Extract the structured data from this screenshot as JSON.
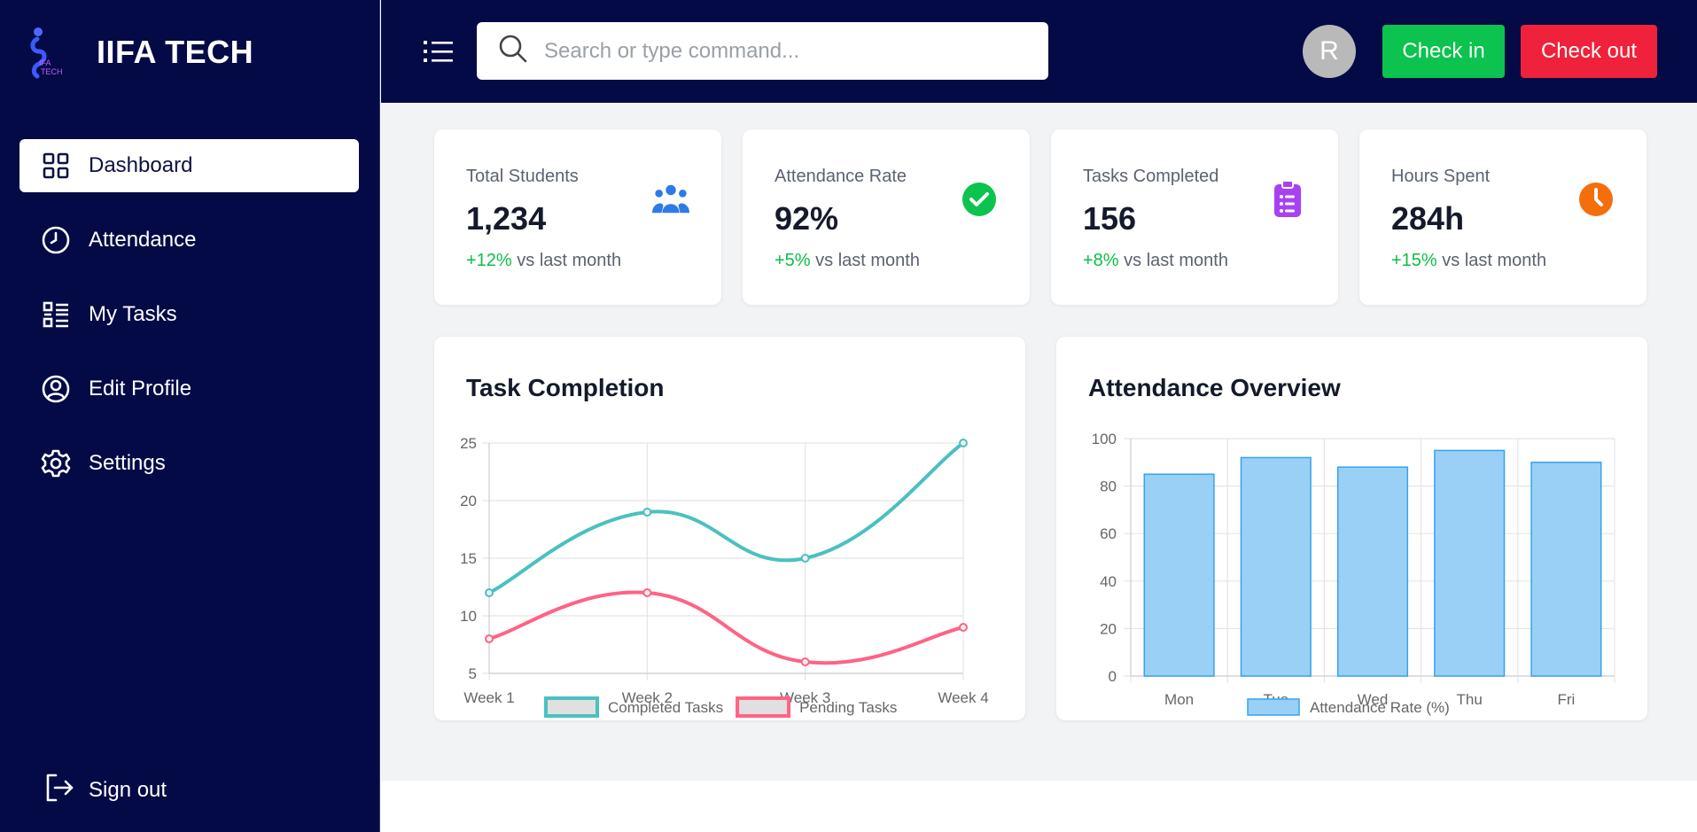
{
  "brand": {
    "name": "IIFA TECH",
    "logo_text": "IFA TECH"
  },
  "sidebar": {
    "items": [
      {
        "label": "Dashboard",
        "icon": "grid-icon",
        "active": true
      },
      {
        "label": "Attendance",
        "icon": "clock-icon",
        "active": false
      },
      {
        "label": "My Tasks",
        "icon": "list-icon",
        "active": false
      },
      {
        "label": "Edit Profile",
        "icon": "user-circle-icon",
        "active": false
      },
      {
        "label": "Settings",
        "icon": "gear-icon",
        "active": false
      }
    ],
    "signout_label": "Sign out"
  },
  "topbar": {
    "search_placeholder": "Search or type command...",
    "avatar_initial": "R",
    "checkin_label": "Check in",
    "checkout_label": "Check out"
  },
  "colors": {
    "navy": "#030a46",
    "checkin": "#0bc34e",
    "checkout": "#f0213a",
    "positive": "#0bbf46"
  },
  "stats": [
    {
      "label": "Total Students",
      "value": "1,234",
      "delta": "+12%",
      "suffix": " vs last month",
      "icon": "users-icon",
      "icon_color": "#2f7be6"
    },
    {
      "label": "Attendance Rate",
      "value": "92%",
      "delta": "+5%",
      "suffix": " vs last month",
      "icon": "check-circle-icon",
      "icon_color": "#0bc34e"
    },
    {
      "label": "Tasks Completed",
      "value": "156",
      "delta": "+8%",
      "suffix": " vs last month",
      "icon": "clipboard-icon",
      "icon_color": "#a742f0"
    },
    {
      "label": "Hours Spent",
      "value": "284h",
      "delta": "+15%",
      "suffix": " vs last month",
      "icon": "clock-filled-icon",
      "icon_color": "#f46e0c"
    }
  ],
  "chart_data": [
    {
      "type": "line",
      "title": "Task Completion",
      "categories": [
        "Week 1",
        "Week 2",
        "Week 3",
        "Week 4"
      ],
      "ylim": [
        5,
        25
      ],
      "yticks": [
        5,
        10,
        15,
        20,
        25
      ],
      "grid": true,
      "legend": "bottom",
      "series": [
        {
          "name": "Completed Tasks",
          "values": [
            12,
            19,
            15,
            25
          ],
          "color": "#4bc0c0"
        },
        {
          "name": "Pending Tasks",
          "values": [
            8,
            12,
            6,
            9
          ],
          "color": "#ff6384"
        }
      ]
    },
    {
      "type": "bar",
      "title": "Attendance Overview",
      "categories": [
        "Mon",
        "Tue",
        "Wed",
        "Thu",
        "Fri"
      ],
      "ylim": [
        0,
        100
      ],
      "yticks": [
        0,
        20,
        40,
        60,
        80,
        100
      ],
      "grid": true,
      "legend": "bottom",
      "series": [
        {
          "name": "Attendance Rate (%)",
          "values": [
            85,
            92,
            88,
            95,
            90
          ],
          "color": "#9ad0f5",
          "border": "#36a2eb"
        }
      ]
    }
  ]
}
